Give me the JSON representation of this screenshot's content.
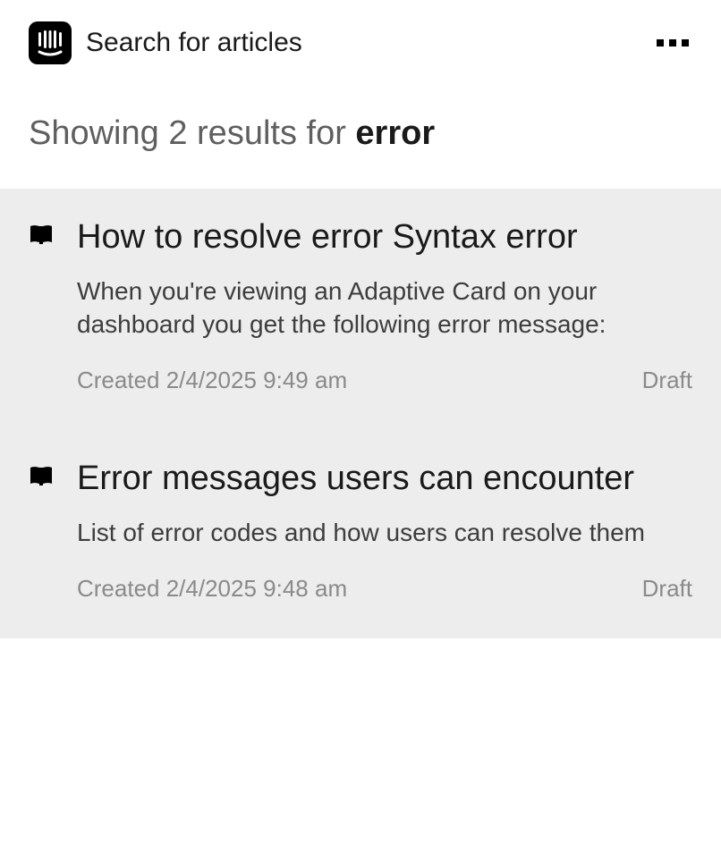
{
  "header": {
    "search_placeholder": "Search for articles"
  },
  "results_summary": {
    "prefix": "Showing ",
    "count": "2",
    "middle": " results for ",
    "query": "error"
  },
  "results": [
    {
      "title": "How to resolve error Syntax error",
      "description": "When you're viewing an Adaptive Card on your dashboard you get the following error message:",
      "created": "Created 2/4/2025 9:49 am",
      "status": "Draft"
    },
    {
      "title": "Error messages users can encounter",
      "description": "List of error codes and how users can resolve them",
      "created": "Created 2/4/2025 9:48 am",
      "status": "Draft"
    }
  ]
}
